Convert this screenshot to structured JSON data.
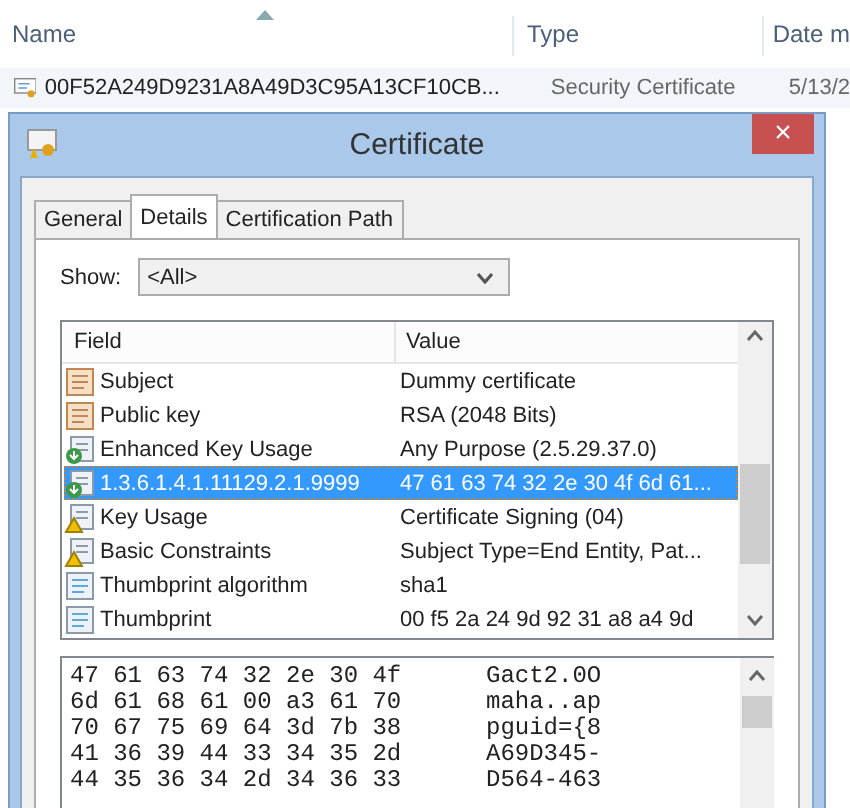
{
  "explorer": {
    "columns": [
      {
        "label": "Name",
        "sorted": true
      },
      {
        "label": "Type",
        "sorted": false
      },
      {
        "label": "Date m",
        "sorted": false
      }
    ],
    "file": {
      "name": "00F52A249D9231A8A49D3C95A13CF10CB...",
      "type": "Security Certificate",
      "date": "5/13/2"
    }
  },
  "window": {
    "title": "Certificate",
    "close": "×"
  },
  "tabs": [
    {
      "label": "General",
      "selected": false
    },
    {
      "label": "Details",
      "selected": true
    },
    {
      "label": "Certification Path",
      "selected": false
    }
  ],
  "show": {
    "label": "Show:",
    "value": "<All>"
  },
  "table": {
    "columns": [
      "Field",
      "Value"
    ],
    "rows": [
      {
        "kind": "cert",
        "field": "Subject",
        "value": "Dummy certificate",
        "selected": false
      },
      {
        "kind": "cert",
        "field": "Public key",
        "value": "RSA (2048 Bits)",
        "selected": false
      },
      {
        "kind": "ext",
        "field": "Enhanced Key Usage",
        "value": "Any Purpose (2.5.29.37.0)",
        "selected": false
      },
      {
        "kind": "ext",
        "field": "1.3.6.1.4.1.11129.2.1.9999",
        "value": "47 61 63 74 32 2e 30 4f 6d 61...",
        "selected": true
      },
      {
        "kind": "warn",
        "field": "Key Usage",
        "value": "Certificate Signing (04)",
        "selected": false
      },
      {
        "kind": "warn",
        "field": "Basic Constraints",
        "value": "Subject Type=End Entity, Pat...",
        "selected": false
      },
      {
        "kind": "plain",
        "field": "Thumbprint algorithm",
        "value": "sha1",
        "selected": false
      },
      {
        "kind": "plain",
        "field": "Thumbprint",
        "value": "00 f5 2a 24 9d 92 31 a8 a4 9d",
        "selected": false
      }
    ]
  },
  "hex": [
    {
      "bytes": "47 61 63 74 32 2e 30 4f",
      "text": "Gact2.0O"
    },
    {
      "bytes": "6d 61 68 61 00 a3 61 70",
      "text": "maha..ap"
    },
    {
      "bytes": "70 67 75 69 64 3d 7b 38",
      "text": "pguid={8"
    },
    {
      "bytes": "41 36 39 44 33 34 35 2d",
      "text": "A69D345-"
    },
    {
      "bytes": "44 35 36 34 2d 34 36 33",
      "text": "D564-463"
    }
  ]
}
